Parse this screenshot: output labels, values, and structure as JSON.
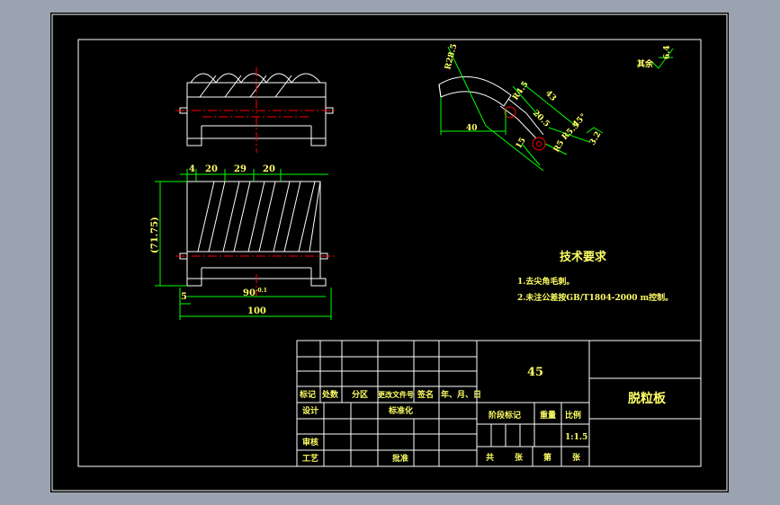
{
  "colors": {
    "app_bg": "#9ba3b0",
    "paper": "#000000",
    "frame": "#ffffff",
    "dimension": "#00ff00",
    "centerline": "#ff0000",
    "text_yellow": "#ffff66",
    "cyan": "#00ffff"
  },
  "top_view": {
    "labels": []
  },
  "front_view": {
    "dims": {
      "d1": "4",
      "d2": "20",
      "d3": "29",
      "d4": "20",
      "height": "(71.75)",
      "left_small": "5",
      "inner_width": "90",
      "inner_tol": "-0.1",
      "overall_width": "100"
    }
  },
  "section_view": {
    "dims": {
      "radius_outer": "R28.5",
      "chord": "40",
      "r_small": "R4.5",
      "r_mid": "20.5",
      "len_top": "43",
      "angle": "45°",
      "chamfer": "R5.5",
      "small_r": "R5",
      "side_15": "15",
      "finish": "3.2"
    }
  },
  "roughness": {
    "label": "其余",
    "value": "6.4"
  },
  "tech_req": {
    "title": "技术要求",
    "items": [
      "1.去尖角毛刺。",
      "2.未注公差按GB/T1804-2000 m控制。"
    ]
  },
  "title_block": {
    "material": "45",
    "part_name": "脱粒板",
    "headers": [
      "标记",
      "处数",
      "分区",
      "更改文件号",
      "签名",
      "年、月、日"
    ],
    "design": "设计",
    "standardize": "标准化",
    "review": "审核",
    "process": "工艺",
    "approve": "批准",
    "stage_mark": "阶段标记",
    "weight": "重量",
    "scale_label": "比例",
    "scale": "1:1.5",
    "total": "共",
    "sheet": "张",
    "number": "第",
    "sheet2": "张"
  }
}
